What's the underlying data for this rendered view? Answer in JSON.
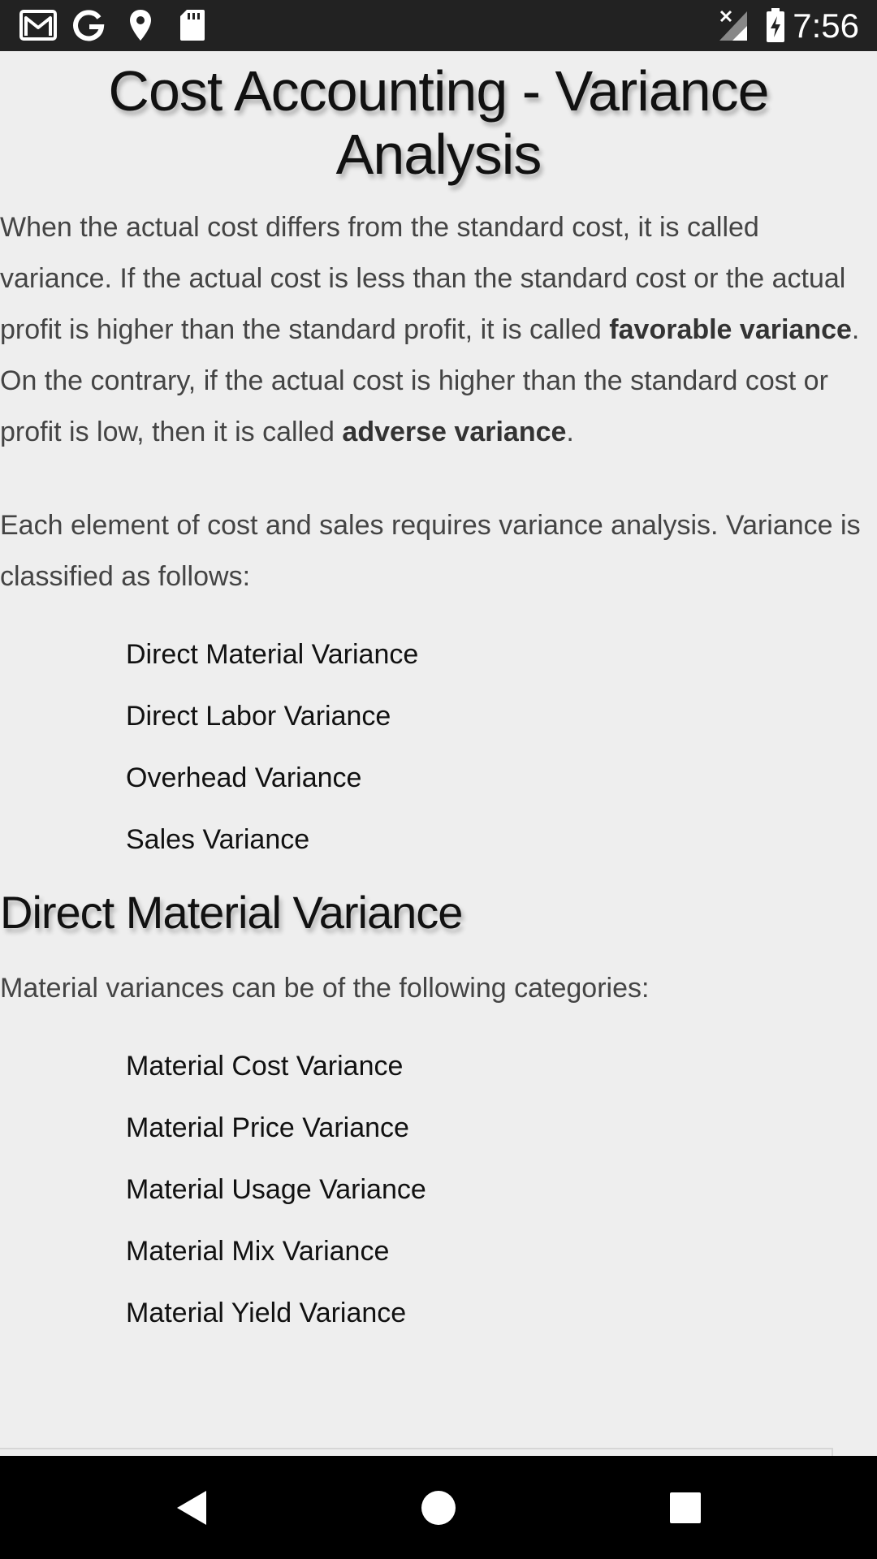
{
  "status_bar": {
    "time": "7:56",
    "icons": [
      "gmail-icon",
      "google-icon",
      "location-pin-icon",
      "sd-card-icon",
      "no-signal-icon",
      "battery-charging-icon"
    ]
  },
  "article": {
    "title": "Cost Accounting - Variance Analysis",
    "intro": {
      "part1": "When the actual cost differs from the standard cost, it is called variance. If the actual cost is less than the standard cost or the actual profit is higher than the standard profit, it is called ",
      "bold1": "favorable variance",
      "part2": ". On the contrary, if the actual cost is higher than the standard cost or profit is low, then it is called ",
      "bold2": "adverse variance",
      "part3": "."
    },
    "classification_text": "Each element of cost and sales requires variance analysis. Variance is classified as follows:",
    "variance_types": [
      "Direct Material Variance",
      "Direct Labor Variance",
      "Overhead Variance",
      "Sales Variance"
    ],
    "section_heading": "Direct Material Variance",
    "section_text": "Material variances can be of the following categories:",
    "material_variances": [
      "Material Cost Variance",
      "Material Price Variance",
      "Material Usage Variance",
      "Material Mix Variance",
      "Material Yield Variance"
    ]
  },
  "nav_bar": {
    "buttons": [
      "back-icon",
      "home-icon",
      "recents-icon"
    ]
  },
  "colors": {
    "background": "#eeeeee",
    "status_bar": "#222222",
    "nav_bar": "#000000",
    "heading_text": "#111111",
    "body_text": "#444444"
  }
}
